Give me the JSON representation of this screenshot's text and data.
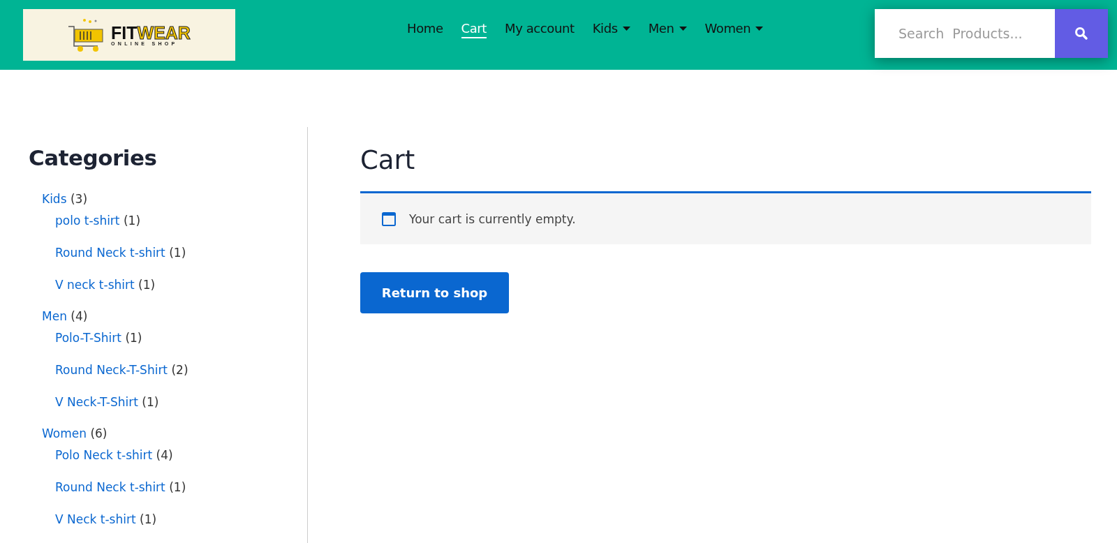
{
  "logo": {
    "word_1": "FIT",
    "word_2": "WEAR",
    "tagline": "ONLINE SHOP"
  },
  "nav": [
    {
      "label": "Home",
      "selected": false,
      "dropdown": false
    },
    {
      "label": "Cart",
      "selected": true,
      "dropdown": false
    },
    {
      "label": "My account",
      "selected": false,
      "dropdown": false
    },
    {
      "label": "Kids",
      "selected": false,
      "dropdown": true
    },
    {
      "label": "Men",
      "selected": false,
      "dropdown": true
    },
    {
      "label": "Women",
      "selected": false,
      "dropdown": true
    }
  ],
  "search": {
    "placeholder": "Search  Products..."
  },
  "sidebar": {
    "title": "Categories",
    "items": [
      {
        "label": "Kids",
        "count": "(3)",
        "children": [
          {
            "label": "polo t-shirt",
            "count": "(1)"
          },
          {
            "label": "Round Neck t-shirt",
            "count": "(1)"
          },
          {
            "label": "V neck t-shirt",
            "count": "(1)"
          }
        ]
      },
      {
        "label": "Men",
        "count": "(4)",
        "children": [
          {
            "label": "Polo-T-Shirt",
            "count": "(1)"
          },
          {
            "label": "Round Neck-T-Shirt",
            "count": "(2)"
          },
          {
            "label": "V Neck-T-Shirt",
            "count": "(1)"
          }
        ]
      },
      {
        "label": "Women",
        "count": "(6)",
        "children": [
          {
            "label": "Polo Neck t-shirt",
            "count": "(4)"
          },
          {
            "label": "Round Neck t-shirt",
            "count": "(1)"
          },
          {
            "label": "V Neck t-shirt",
            "count": "(1)"
          }
        ]
      }
    ]
  },
  "main": {
    "title": "Cart",
    "notice": "Your cart is currently empty.",
    "button": "Return to shop"
  }
}
